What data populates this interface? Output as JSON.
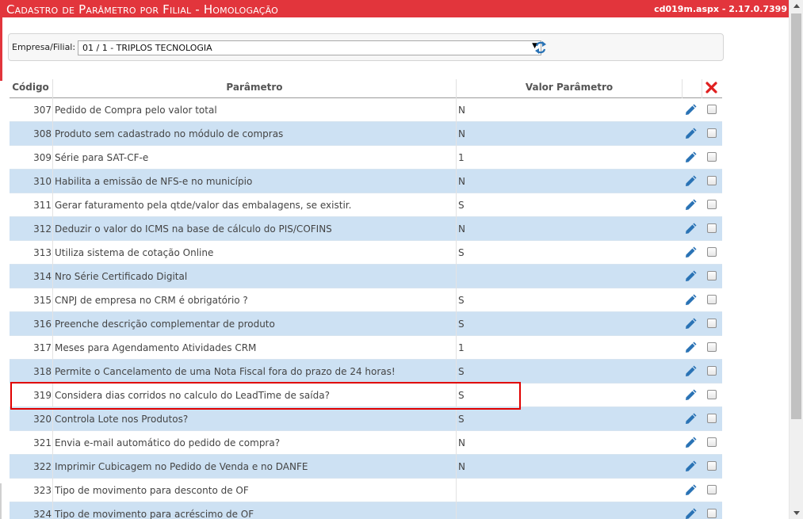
{
  "window": {
    "title": "Cadastro de Parâmetro por Filial  - Homologação",
    "version": "cd019m.aspx - 2.17.0.7399"
  },
  "filter": {
    "label": "Empresa/Filial:",
    "selected": "01 / 1 - TRIPLOS TECNOLOGIA"
  },
  "columns": {
    "code": "Código",
    "param": "Parâmetro",
    "value": "Valor Parâmetro"
  },
  "rows": [
    {
      "code": "307",
      "param": "Pedido de Compra pelo valor total",
      "value": "N"
    },
    {
      "code": "308",
      "param": "Produto sem cadastrado no módulo de compras",
      "value": "N"
    },
    {
      "code": "309",
      "param": "Série para SAT-CF-e",
      "value": "1"
    },
    {
      "code": "310",
      "param": "Habilita a emissão de NFS-e no município",
      "value": "N"
    },
    {
      "code": "311",
      "param": "Gerar faturamento pela qtde/valor das embalagens, se existir.",
      "value": "S"
    },
    {
      "code": "312",
      "param": "Deduzir o valor do ICMS na base de cálculo do PIS/COFINS",
      "value": "N"
    },
    {
      "code": "313",
      "param": "Utiliza sistema de cotação Online",
      "value": "S"
    },
    {
      "code": "314",
      "param": "Nro Série Certificado Digital",
      "value": ""
    },
    {
      "code": "315",
      "param": "CNPJ de empresa no CRM é obrigatório ?",
      "value": "S"
    },
    {
      "code": "316",
      "param": "Preenche descrição complementar de produto",
      "value": "S"
    },
    {
      "code": "317",
      "param": "Meses para Agendamento Atividades CRM",
      "value": "1"
    },
    {
      "code": "318",
      "param": "Permite o Cancelamento de uma Nota Fiscal fora do prazo de 24 horas!",
      "value": "S"
    },
    {
      "code": "319",
      "param": "Considera dias corridos no calculo do LeadTime de saída?",
      "value": "S"
    },
    {
      "code": "320",
      "param": "Controla Lote nos Produtos?",
      "value": "S"
    },
    {
      "code": "321",
      "param": "Envia e-mail automático do pedido de compra?",
      "value": "N"
    },
    {
      "code": "322",
      "param": "Imprimir Cubicagem no Pedido de Venda e no DANFE",
      "value": "N"
    },
    {
      "code": "323",
      "param": "Tipo de movimento para desconto de OF",
      "value": ""
    },
    {
      "code": "324",
      "param": "Tipo de movimento para acréscimo de OF",
      "value": ""
    }
  ],
  "colors": {
    "titlebar": "#e2353c",
    "row_alt": "#cde1f3",
    "highlight": "#e00000",
    "edit_icon": "#2a73b5",
    "delete_icon": "#e02020"
  },
  "icons": {
    "refresh": "refresh-icon",
    "edit": "pencil-icon",
    "delete_all": "delete-x-icon"
  }
}
